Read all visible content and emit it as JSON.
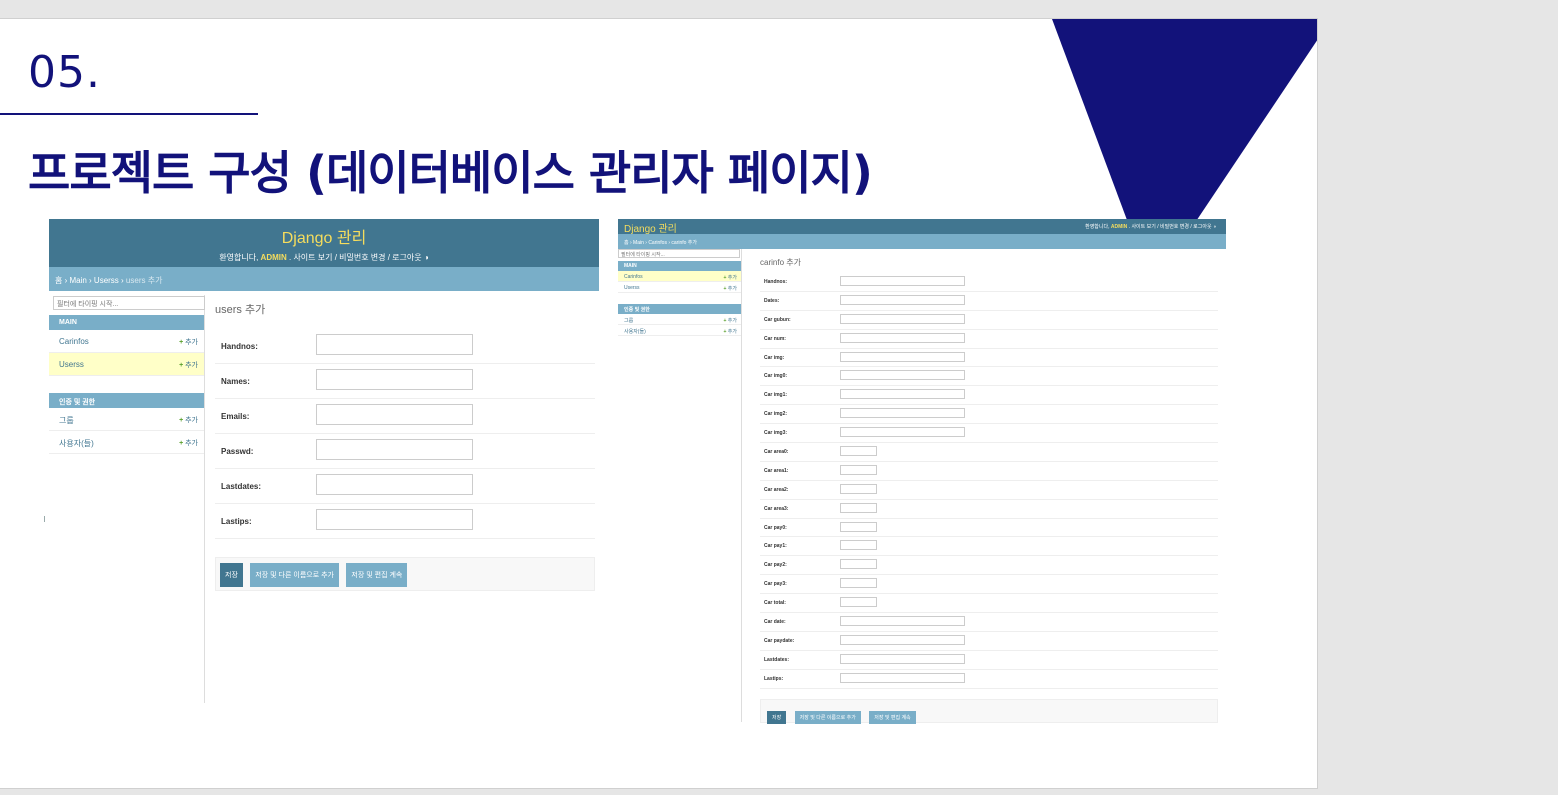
{
  "slide": {
    "number": "05.",
    "title": "프로젝트 구성 (데이터베이스 관리자 페이지)",
    "accent_color": "#12127a"
  },
  "admin1": {
    "brand": "Django 관리",
    "welcome": "환영합니다,",
    "user": "ADMIN",
    "tool_links": ". 사이트 보기 / 비밀번호 변경 / 로그아웃",
    "theme_icon": "◑",
    "breadcrumbs": "홈 › Main › Userss › ",
    "breadcrumb_current": "users 추가",
    "filter_placeholder": "필터에 타이핑 시작...",
    "sections": [
      {
        "title": "MAIN",
        "items": [
          {
            "label": "Carinfos",
            "add": "추가"
          },
          {
            "label": "Userss",
            "add": "추가"
          }
        ]
      },
      {
        "title": "인증 및 권한",
        "items": [
          {
            "label": "그룹",
            "add": "추가"
          },
          {
            "label": "사용자(들)",
            "add": "추가"
          }
        ]
      }
    ],
    "page_title": "users 추가",
    "fields": [
      "Handnos:",
      "Names:",
      "Emails:",
      "Passwd:",
      "Lastdates:",
      "Lastips:"
    ],
    "buttons": {
      "save": "저장",
      "save_add": "저장 및 다른 이름으로 추가",
      "save_continue": "저장 및 편집 계속"
    }
  },
  "admin2": {
    "brand": "Django 관리",
    "welcome": "환영합니다,",
    "user": "ADMIN",
    "tool_links": ". 사이트 보기 / 비밀번호 변경 / 로그아웃",
    "theme_icon": "◑",
    "breadcrumbs": "홈 › Main › Carinfos › ",
    "breadcrumb_current": "carinfo 추가",
    "filter_placeholder": "필터에 타이핑 시작...",
    "sections": [
      {
        "title": "MAIN",
        "items": [
          {
            "label": "Carinfos",
            "add": "추가"
          },
          {
            "label": "Userss",
            "add": "추가"
          }
        ]
      },
      {
        "title": "인증 및 권한",
        "items": [
          {
            "label": "그룹",
            "add": "추가"
          },
          {
            "label": "사용자(들)",
            "add": "추가"
          }
        ]
      }
    ],
    "page_title": "carinfo 추가",
    "fields": [
      "Handnos:",
      "Dates:",
      "Car gubun:",
      "Car num:",
      "Car img:",
      "Car img0:",
      "Car img1:",
      "Car img2:",
      "Car img3:",
      "Car area0:",
      "Car area1:",
      "Car area2:",
      "Car area3:",
      "Car pay0:",
      "Car pay1:",
      "Car pay2:",
      "Car pay3:",
      "Car total:",
      "Car date:",
      "Car paydate:",
      "Lastdates:",
      "Lastips:"
    ],
    "short_fields": [
      "Car area0:",
      "Car area1:",
      "Car area2:",
      "Car area3:",
      "Car pay0:",
      "Car pay1:",
      "Car pay2:",
      "Car pay3:",
      "Car total:"
    ],
    "buttons": {
      "save": "저장",
      "save_add": "저장 및 다른 이름으로 추가",
      "save_continue": "저장 및 편집 계속"
    }
  }
}
